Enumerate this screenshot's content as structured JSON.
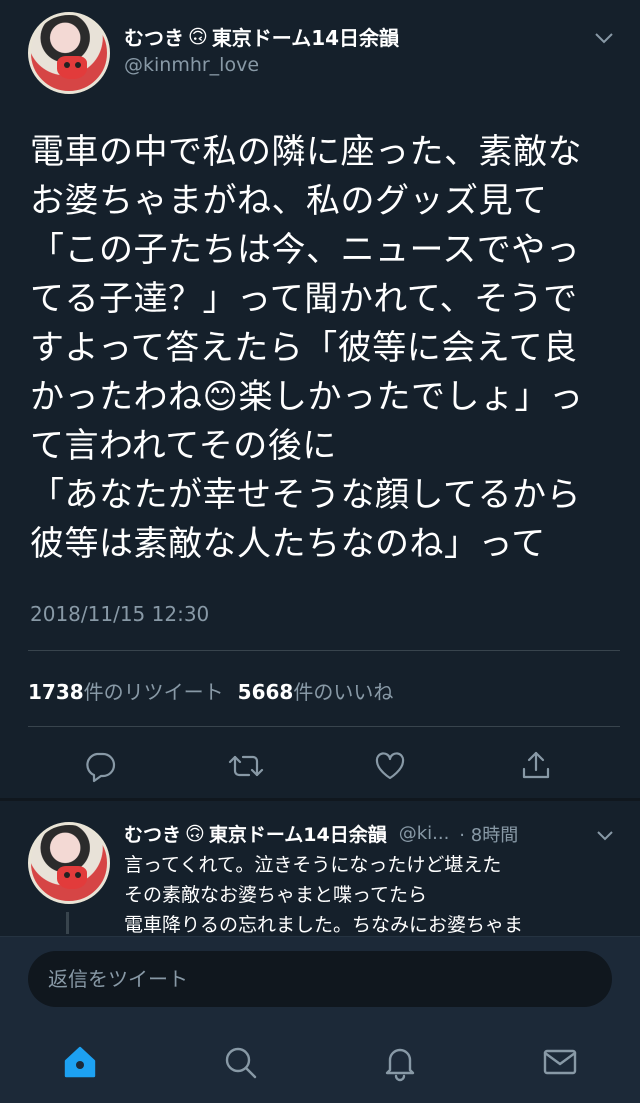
{
  "tweet": {
    "display_name": "むつき",
    "name_emoji": "🙃",
    "name_suffix": "東京ドーム14日余韻",
    "handle": "@kinmhr_love",
    "text_lines": [
      "電車の中で私の隣に座った、素敵な",
      "お婆ちゃまがね、私のグッズ見て",
      "「この子たちは今、ニュースでやっ",
      "てる子達？」って聞かれて、そうで",
      "すよって答えたら「彼等に会えて良",
      "かったわね😊楽しかったでしょ」っ",
      "て言われてその後に",
      "「あなたが幸せそうな顔してるから",
      "彼等は素敵な人たちなのね」って"
    ],
    "timestamp": "2018/11/15 12:30",
    "retweet_count": "1738",
    "retweet_label": "件のリツイート",
    "like_count": "5668",
    "like_label": "件のいいね"
  },
  "actions": {
    "reply_icon": "reply-icon",
    "retweet_icon": "retweet-icon",
    "like_icon": "heart-icon",
    "share_icon": "share-icon"
  },
  "reply": {
    "display_name": "むつき",
    "name_emoji": "🙃",
    "name_suffix": "東京ドーム14日余韻",
    "handle": "@ki...",
    "time": "· 8時間",
    "text_lines": [
      "言ってくれて。泣きそうになったけど堪えた",
      "その素敵なお婆ちゃまと喋ってたら",
      "電車降りるの忘れました。ちなみにお婆ちゃま"
    ]
  },
  "compose": {
    "placeholder": "返信をツイート"
  },
  "tabbar": {
    "items": [
      "home-icon",
      "search-icon",
      "notifications-icon",
      "messages-icon"
    ]
  },
  "colors": {
    "background": "#15202b",
    "accent": "#1da1f2",
    "muted": "#8899a6"
  }
}
